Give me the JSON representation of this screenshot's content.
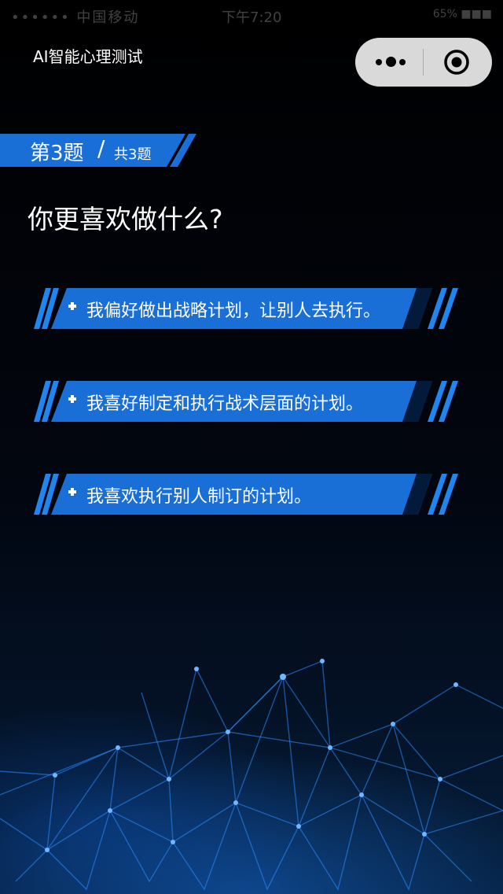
{
  "status_bar": {
    "left_text": "•••••• 中国移动",
    "time": "下午7:20",
    "right_text": "65% ■■■"
  },
  "nav": {
    "title": "AI智能心理测试",
    "more_icon": "more-dots-icon",
    "close_icon": "target-circle-icon"
  },
  "question_badge": {
    "current": "第3题",
    "separator": "/",
    "total": "共3题"
  },
  "question": {
    "text": "你更喜欢做什么?"
  },
  "options": [
    {
      "label": "我偏好做出战略计划，让别人去执行。"
    },
    {
      "label": "我喜好制定和执行战术层面的计划。"
    },
    {
      "label": "我喜欢执行别人制订的计划。"
    }
  ],
  "colors": {
    "accent": "#1a6fd6",
    "accent_light": "#1f86f0",
    "background": "#000000",
    "capsule": "#d9d9d9"
  }
}
